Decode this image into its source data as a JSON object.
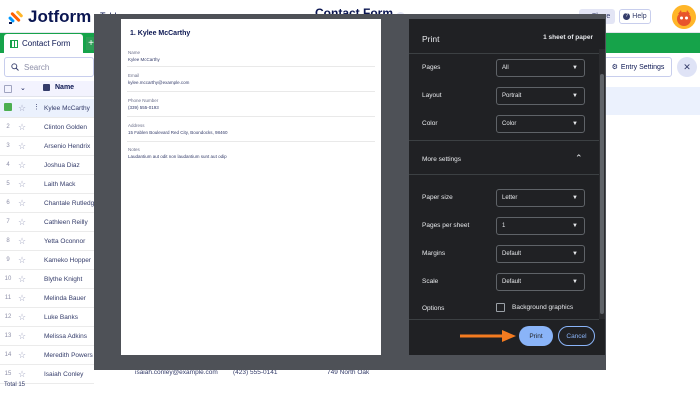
{
  "app": {
    "logo_text": "Jotform",
    "tables_link": "Tables",
    "form_title": "Contact Form",
    "share_label": "Share",
    "help_label": "Help"
  },
  "tabs": {
    "active": "Contact Form",
    "plus": "+"
  },
  "toolbar": {
    "search_placeholder": "Search",
    "entry_settings": "Entry Settings"
  },
  "table": {
    "name_header": "Name",
    "rows": [
      {
        "num": "1",
        "name": "Kylee McCarthy"
      },
      {
        "num": "2",
        "name": "Clinton Golden"
      },
      {
        "num": "3",
        "name": "Arsenio Hendrix"
      },
      {
        "num": "4",
        "name": "Joshua Diaz"
      },
      {
        "num": "5",
        "name": "Laith Mack"
      },
      {
        "num": "6",
        "name": "Chantale Rutledg"
      },
      {
        "num": "7",
        "name": "Cathleen Reilly"
      },
      {
        "num": "8",
        "name": "Yetta Oconnor"
      },
      {
        "num": "9",
        "name": "Kameko Hopper"
      },
      {
        "num": "10",
        "name": "Blythe Knight"
      },
      {
        "num": "11",
        "name": "Melinda Bauer"
      },
      {
        "num": "12",
        "name": "Luke Banks"
      },
      {
        "num": "13",
        "name": "Melissa Adkins"
      },
      {
        "num": "14",
        "name": "Meredith Powers"
      },
      {
        "num": "15",
        "name": "Isaiah Conley"
      }
    ],
    "last_row_email": "isaiah.conley@example.com",
    "last_row_phone": "(423) 555-0141",
    "last_row_address": "749 North Oak",
    "total": "Total 15"
  },
  "preview": {
    "title": "1. Kylee McCarthy",
    "fields": [
      {
        "label": "Name",
        "value": "Kylee McCarthy"
      },
      {
        "label": "Email",
        "value": "kylee.mccarthy@example.com"
      },
      {
        "label": "Phone Number",
        "value": "(339) 555-0193"
      },
      {
        "label": "Address",
        "value": "15 Fablen Boulevard Red City, Boondocks, 98460"
      },
      {
        "label": "Notes",
        "value": "Laudantium aut odit non laudantium sunt aut odip"
      }
    ]
  },
  "print": {
    "title": "Print",
    "sheets": "1 sheet of paper",
    "pages_label": "Pages",
    "pages_value": "All",
    "layout_label": "Layout",
    "layout_value": "Portrait",
    "color_label": "Color",
    "color_value": "Color",
    "more_settings": "More settings",
    "paper_size_label": "Paper size",
    "paper_size_value": "Letter",
    "pages_per_sheet_label": "Pages per sheet",
    "pages_per_sheet_value": "1",
    "margins_label": "Margins",
    "margins_value": "Default",
    "scale_label": "Scale",
    "scale_value": "Default",
    "options_label": "Options",
    "background_graphics": "Background graphics",
    "print_button": "Print",
    "cancel_button": "Cancel"
  },
  "colors": {
    "brand_navy": "#0a1551",
    "jotform_green": "#16a34a",
    "print_accent": "#8ab4f8",
    "arrow_orange": "#f47b20",
    "dialog_bg": "#202124"
  }
}
